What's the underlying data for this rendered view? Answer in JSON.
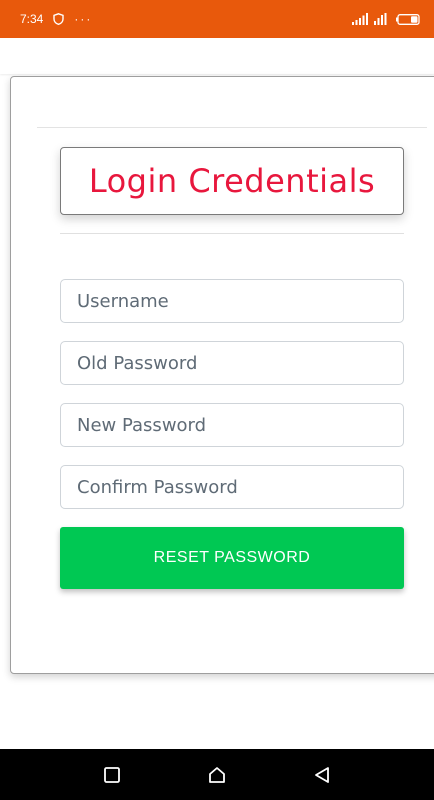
{
  "status_bar": {
    "time": "7:34",
    "overflow_dots": "···",
    "background_color": "#e8590c"
  },
  "card": {
    "title": "Login Credentials",
    "title_color": "#e8173d"
  },
  "form": {
    "username_placeholder": "Username",
    "old_password_placeholder": "Old Password",
    "new_password_placeholder": "New Password",
    "confirm_password_placeholder": "Confirm Password",
    "reset_button_label": "RESET PASSWORD",
    "reset_button_color": "#00c853"
  },
  "nav_bar": {
    "buttons": [
      "recents-square-icon",
      "home-icon",
      "back-triangle-icon"
    ]
  }
}
